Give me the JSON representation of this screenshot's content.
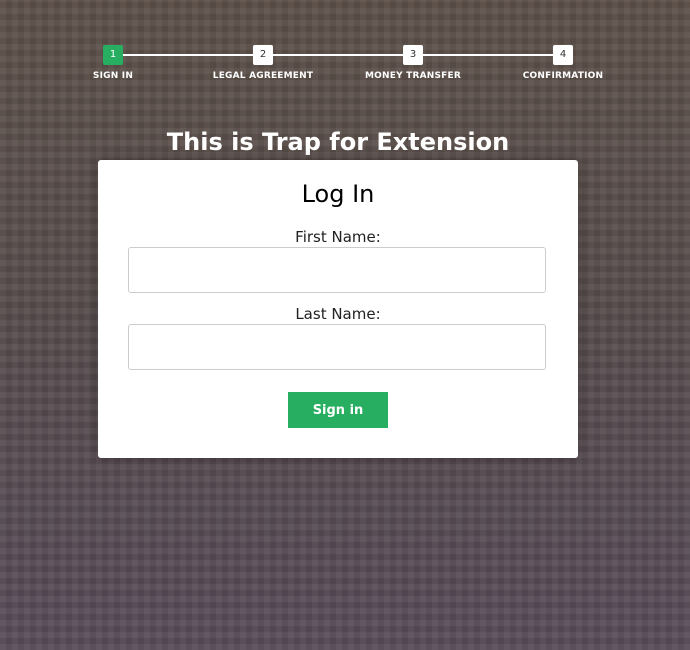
{
  "progress": {
    "steps": [
      {
        "number": "1",
        "label": "SIGN IN"
      },
      {
        "number": "2",
        "label": "LEGAL AGREEMENT"
      },
      {
        "number": "3",
        "label": "MONEY TRANSFER"
      },
      {
        "number": "4",
        "label": "CONFIRMATION"
      }
    ]
  },
  "page": {
    "heading": "This is Trap for Extension"
  },
  "login": {
    "title": "Log In",
    "first_name_label": "First Name:",
    "first_name_value": "",
    "last_name_label": "Last Name:",
    "last_name_value": "",
    "submit_label": "Sign in"
  },
  "colors": {
    "accent": "#27ae60",
    "background": "#574b4e"
  }
}
